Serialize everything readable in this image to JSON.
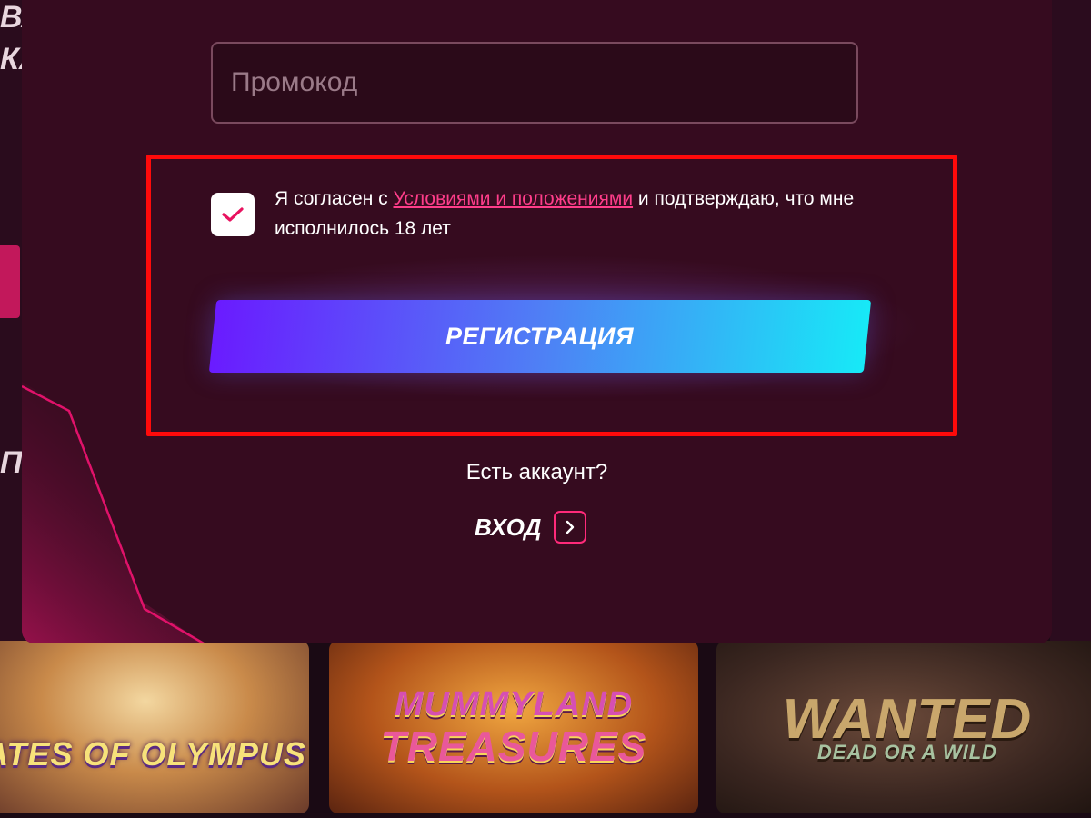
{
  "background": {
    "left_fragments": [
      "ВА",
      "КА",
      "П"
    ],
    "games": [
      {
        "title": "ATES OF OLYMPUS",
        "subtitle": ""
      },
      {
        "title": "MUMMYLAND",
        "subtitle": "TREASURES"
      },
      {
        "title": "WANTED",
        "subtitle": "DEAD OR A WILD"
      }
    ]
  },
  "form": {
    "promo_placeholder": "Промокод",
    "promo_value": "",
    "terms": {
      "checked": true,
      "prefix": "Я согласен с ",
      "link_text": "Условиями и положениями",
      "suffix": " и подтверждаю, что мне исполнилось 18 лет"
    },
    "register_label": "РЕГИСТРАЦИЯ",
    "have_account": "Есть аккаунт?",
    "login_label": "ВХОД"
  },
  "colors": {
    "modal_bg": "#360b1f",
    "accent_pink": "#ff3d8a",
    "highlight_red": "#ff0a0a",
    "button_gradient_start": "#6a1bff",
    "button_gradient_end": "#17e9f7"
  },
  "icons": {
    "checkbox": "checkmark-icon",
    "login": "chevron-right-icon"
  }
}
